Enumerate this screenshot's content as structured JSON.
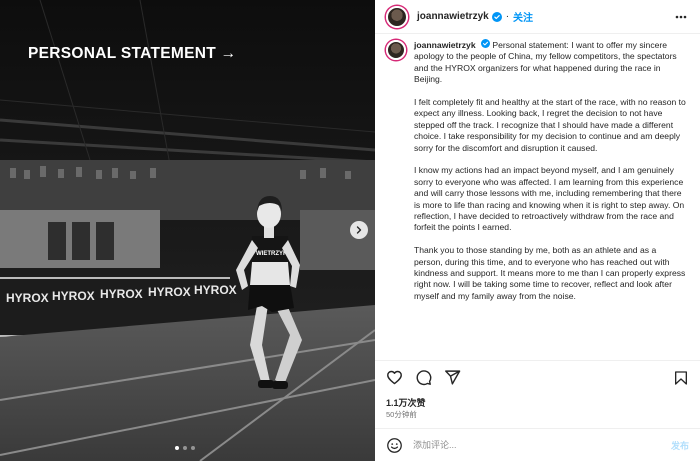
{
  "media": {
    "title": "PERSONAL STATEMENT →",
    "banner_text": "HYROX",
    "bib_text": "WIETRZYK",
    "dots": 3,
    "active_dot": 0
  },
  "header": {
    "username": "joannawietrzyk",
    "follow_label": "关注",
    "separator": "·"
  },
  "caption": {
    "username": "joannawietrzyk",
    "first_paragraph": "Personal statement: I want to offer my sincere apology to the people of China, my fellow competitors, the spectators and the HYROX organizers for what happened during the race in Beijing.",
    "paragraphs": [
      "I felt completely fit and healthy at the start of the race, with no reason to expect any illness. Looking back, I regret the decision to not have stepped off the track. I recognize that I should have made a different choice. I take responsibility for my decision to continue and am deeply sorry for the discomfort and disruption it caused.",
      "I know my actions had an impact beyond myself, and I am genuinely sorry to everyone who was affected. I am learning from this experience and will carry those lessons with me, including remembering that there is more to life than racing and knowing when it is right to step away. On reflection, I have decided to retroactively withdraw from the race and forfeit the points I earned.",
      "Thank you to those standing by me, both as an athlete and as a person, during this time, and to everyone who has reached out with kindness and support. It means more to me than I can properly express right now. I will be taking some time to recover, reflect and look after myself and my family away from the noise."
    ]
  },
  "engagement": {
    "likes": "1.1万次赞",
    "time": "50分钟前"
  },
  "comment": {
    "placeholder": "添加评论...",
    "post_label": "发布"
  },
  "icons": {
    "like": "heart-icon",
    "comment": "comment-icon",
    "share": "share-icon",
    "save": "bookmark-icon",
    "more": "more-icon",
    "next": "chevron-right-icon",
    "emoji": "emoji-icon",
    "verified": "verified-badge-icon"
  },
  "colors": {
    "accent": "#0095f6",
    "verified": "#0095f6",
    "post_disabled": "#b2dffc",
    "story_ring": "#d62976"
  }
}
